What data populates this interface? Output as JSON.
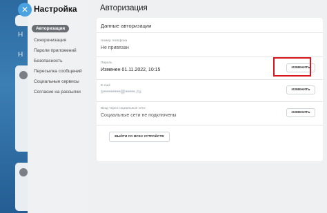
{
  "close_icon": "close-icon",
  "background": {
    "letters": [
      "Н",
      "Н"
    ]
  },
  "sidebar": {
    "title": "Настройка",
    "items": [
      {
        "label": "Авторизация",
        "active": true
      },
      {
        "label": "Синхронизация"
      },
      {
        "label": "Пароли приложений"
      },
      {
        "label": "Безопасность"
      },
      {
        "label": "Пересылка сообщений"
      },
      {
        "label": "Социальные сервисы"
      },
      {
        "label": "Согласие на рассылки"
      }
    ]
  },
  "main": {
    "title": "Авторизация",
    "card_header": "Данные авторизации",
    "phone": {
      "label": "Номер телефона",
      "value": "Не привязан"
    },
    "password": {
      "label": "Пароль",
      "value": "Изменен 01.11.2022, 10:15",
      "button": "ИЗМЕНИТЬ"
    },
    "email": {
      "label": "E-mail",
      "value": "s•••••••••@•••••.ru",
      "button": "ИЗМЕНИТЬ"
    },
    "social": {
      "label": "Вход через социальные сети",
      "value": "Социальные сети не подключены",
      "button": "ИЗМЕНИТЬ"
    },
    "logout_button": "ВЫЙТИ СО ВСЕХ УСТРОЙСТВ"
  },
  "colors": {
    "accent": "#4aa3e0",
    "highlight": "#d8131b",
    "active_nav": "#6b6f74"
  }
}
